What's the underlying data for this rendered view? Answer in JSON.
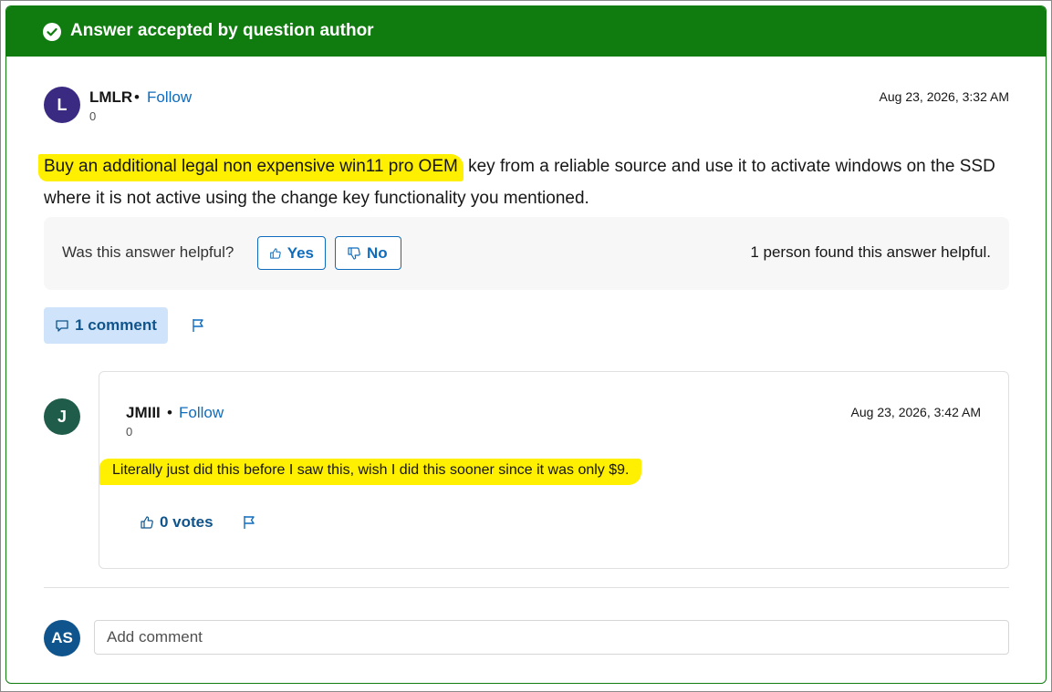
{
  "banner": {
    "title": "Answer accepted by question author",
    "color": "#107c10"
  },
  "answer": {
    "author": {
      "initial": "L",
      "name": "LMLR",
      "separator": "•",
      "follow_label": "Follow",
      "reputation": "0",
      "avatar_color": "#3b2a82"
    },
    "timestamp": "Aug 23, 2026, 3:32 AM",
    "body_highlighted": "Buy an additional legal non expensive win11 pro OEM",
    "body_rest": " key from a reliable source and use it to activate windows on the SSD where it is not active using the change key functionality you mentioned.",
    "highlight_color": "#ffef00"
  },
  "helpful": {
    "question": "Was this answer helpful?",
    "yes_label": "Yes",
    "no_label": "No",
    "count_text": "1 person found this answer helpful."
  },
  "comments_button": {
    "label": "1 comment"
  },
  "reply": {
    "author": {
      "initial": "J",
      "name": "JMIII",
      "separator": "•",
      "follow_label": "Follow",
      "reputation": "0",
      "avatar_color": "#1f5c4a"
    },
    "timestamp": "Aug 23, 2026, 3:42 AM",
    "body": "Literally just did this before I saw this, wish I did this sooner since it was only $9.",
    "votes_label": "0 votes"
  },
  "add_comment": {
    "initial": "AS",
    "placeholder": "Add comment",
    "avatar_color": "#0f548c"
  },
  "icons": {
    "check": "check-circle-icon",
    "thumb_up": "thumbs-up-icon",
    "thumb_down": "thumbs-down-icon",
    "comment": "comment-icon",
    "flag": "flag-icon"
  }
}
